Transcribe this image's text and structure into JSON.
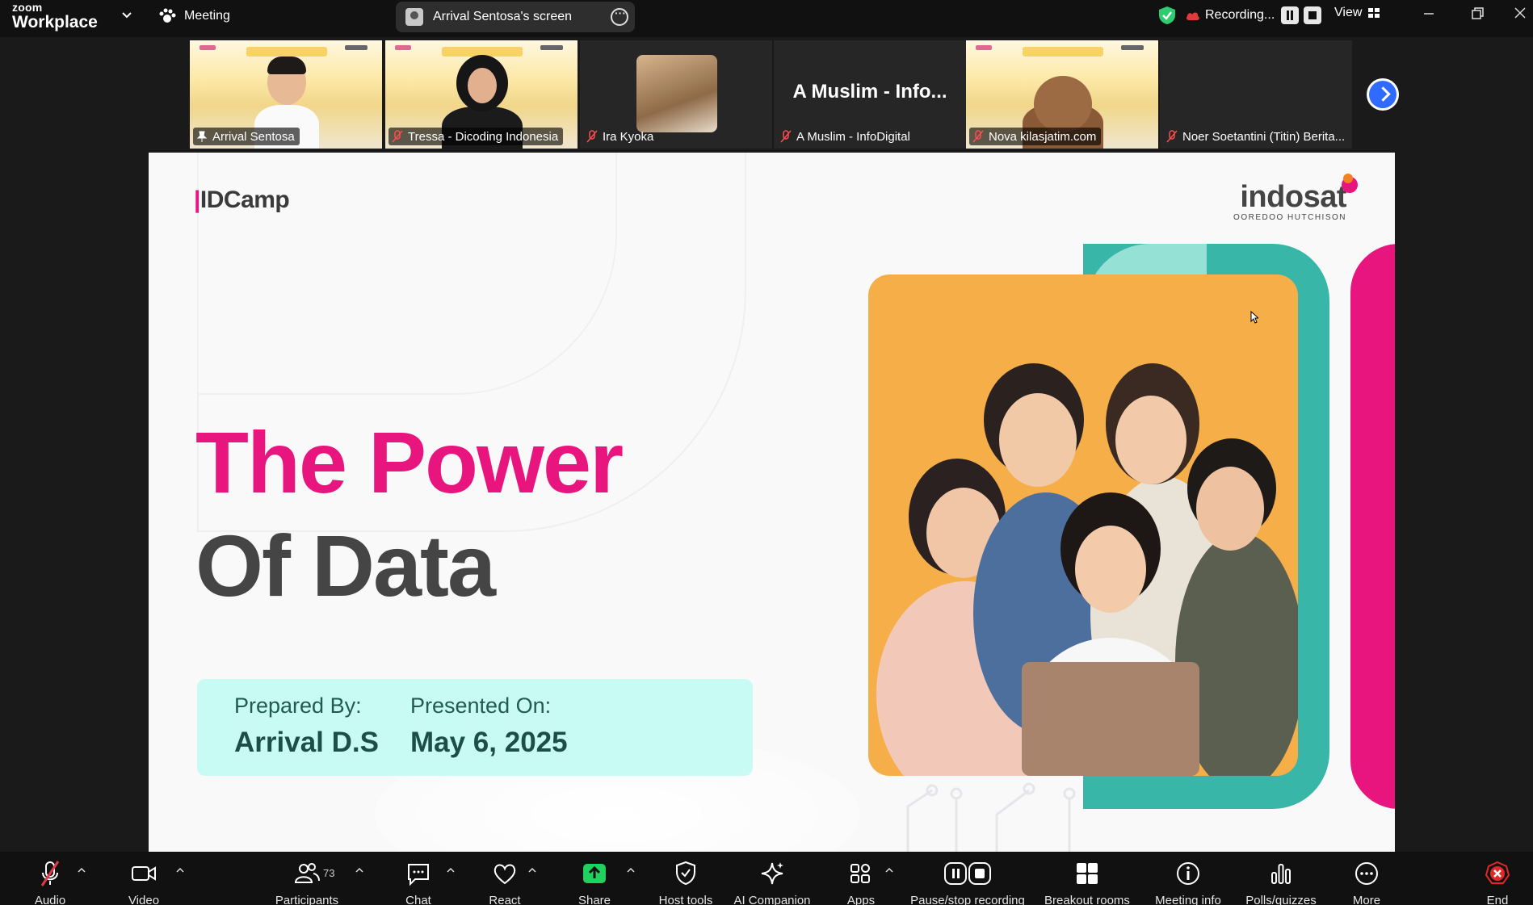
{
  "app": {
    "brand_top": "zoom",
    "brand_bottom": "Workplace"
  },
  "topbar": {
    "meeting_label": "Meeting",
    "screen_share_label": "Arrival Sentosa's screen",
    "recording_label": "Recording...",
    "view_label": "View",
    "colors": {
      "shield": "#2ecc71",
      "recording_cloud": "#e03b3b"
    }
  },
  "gallery": {
    "tiles": [
      {
        "name": "Arrival Sentosa",
        "mic": "pinned",
        "video": true
      },
      {
        "name": "Tressa - Dicoding Indonesia",
        "mic": "muted",
        "video": true
      },
      {
        "name": "Ira Kyoka",
        "mic": "muted",
        "video": false
      },
      {
        "name": "A Muslim - InfoDigital",
        "display": "A Muslim - Info...",
        "mic": "muted",
        "video": false
      },
      {
        "name": "Nova kilasjatim.com",
        "mic": "muted",
        "video": true
      },
      {
        "name": "Noer Soetantini (Titin) Berita...",
        "mic": "muted",
        "video": false
      }
    ]
  },
  "slide": {
    "logo_left": "IDCamp",
    "logo_right": "indosat",
    "logo_right_sub": "OOREDOO HUTCHISON",
    "title_line1": "The Power",
    "title_line2": "Of Data",
    "prepared_label": "Prepared By:",
    "prepared_value": "Arrival D.S",
    "presented_label": "Presented On:",
    "presented_value": "May 6, 2025",
    "colors": {
      "pink": "#e8157e",
      "teal": "#38b6a8",
      "orange": "#f6ae49",
      "info_bg": "#c9fbf5"
    }
  },
  "toolbar": {
    "audio": "Audio",
    "video": "Video",
    "participants": "Participants",
    "participants_count": "73",
    "chat": "Chat",
    "react": "React",
    "share": "Share",
    "host_tools": "Host tools",
    "ai_companion": "AI Companion",
    "apps": "Apps",
    "pause_stop_recording": "Pause/stop recording",
    "breakout_rooms": "Breakout rooms",
    "meeting_info": "Meeting info",
    "polls": "Polls/quizzes",
    "more": "More",
    "end": "End",
    "colors": {
      "share": "#1fd15f",
      "end": "#e02828"
    }
  }
}
